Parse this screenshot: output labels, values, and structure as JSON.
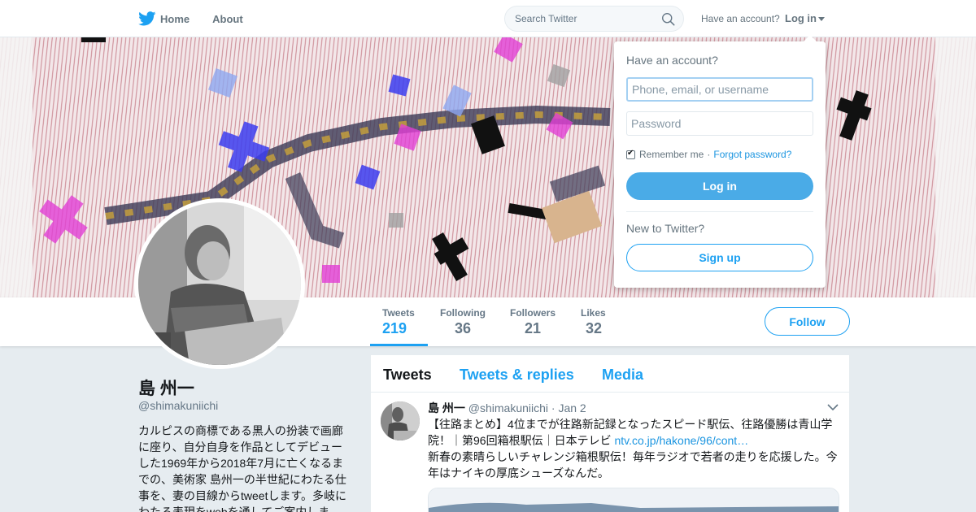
{
  "nav": {
    "home_label": "Home",
    "about_label": "About",
    "search_placeholder": "Search Twitter",
    "have_account": "Have an account?",
    "login_label": "Log in"
  },
  "profile": {
    "name": "島 州一",
    "handle": "@shimakuniichi",
    "bio": "カルピスの商標である黒人の扮装で画廊に座り、自分自身を作品としてデビューした1969年から2018年7月に亡くなるまでの、美術家 島州一の半世紀にわたる仕事を、妻の目線からtweetします。多岐にわたる表現をwebを通してご案内しま"
  },
  "stats": [
    {
      "label": "Tweets",
      "value": "219"
    },
    {
      "label": "Following",
      "value": "36"
    },
    {
      "label": "Followers",
      "value": "21"
    },
    {
      "label": "Likes",
      "value": "32"
    }
  ],
  "follow_label": "Follow",
  "timeline": {
    "tabs": [
      "Tweets",
      "Tweets & replies",
      "Media"
    ],
    "tweet": {
      "name": "島 州一",
      "handle_date": "@shimakuniichi · Jan 2",
      "text_line1": "【往路まとめ】4位までが往路新記録となったスピード駅伝、往路優勝は青山学院！｜第96回箱根駅伝｜日本テレビ ",
      "link": "ntv.co.jp/hakone/96/cont…",
      "text_line2": "新春の素晴らしいチャレンジ箱根駅伝！毎年ラジオで若者の走りを応援した。今年はナイキの厚底シューズなんだ。"
    }
  },
  "login_dropdown": {
    "title": "Have an account?",
    "username_placeholder": "Phone, email, or username",
    "password_placeholder": "Password",
    "remember_label": "Remember me",
    "separator": "·",
    "forgot_label": "Forgot password?",
    "login_button": "Log in",
    "new_label": "New to Twitter?",
    "signup_button": "Sign up"
  },
  "colors": {
    "accent": "#1da1f2",
    "login_button": "#4aabe7",
    "background": "#e6ecf0"
  }
}
